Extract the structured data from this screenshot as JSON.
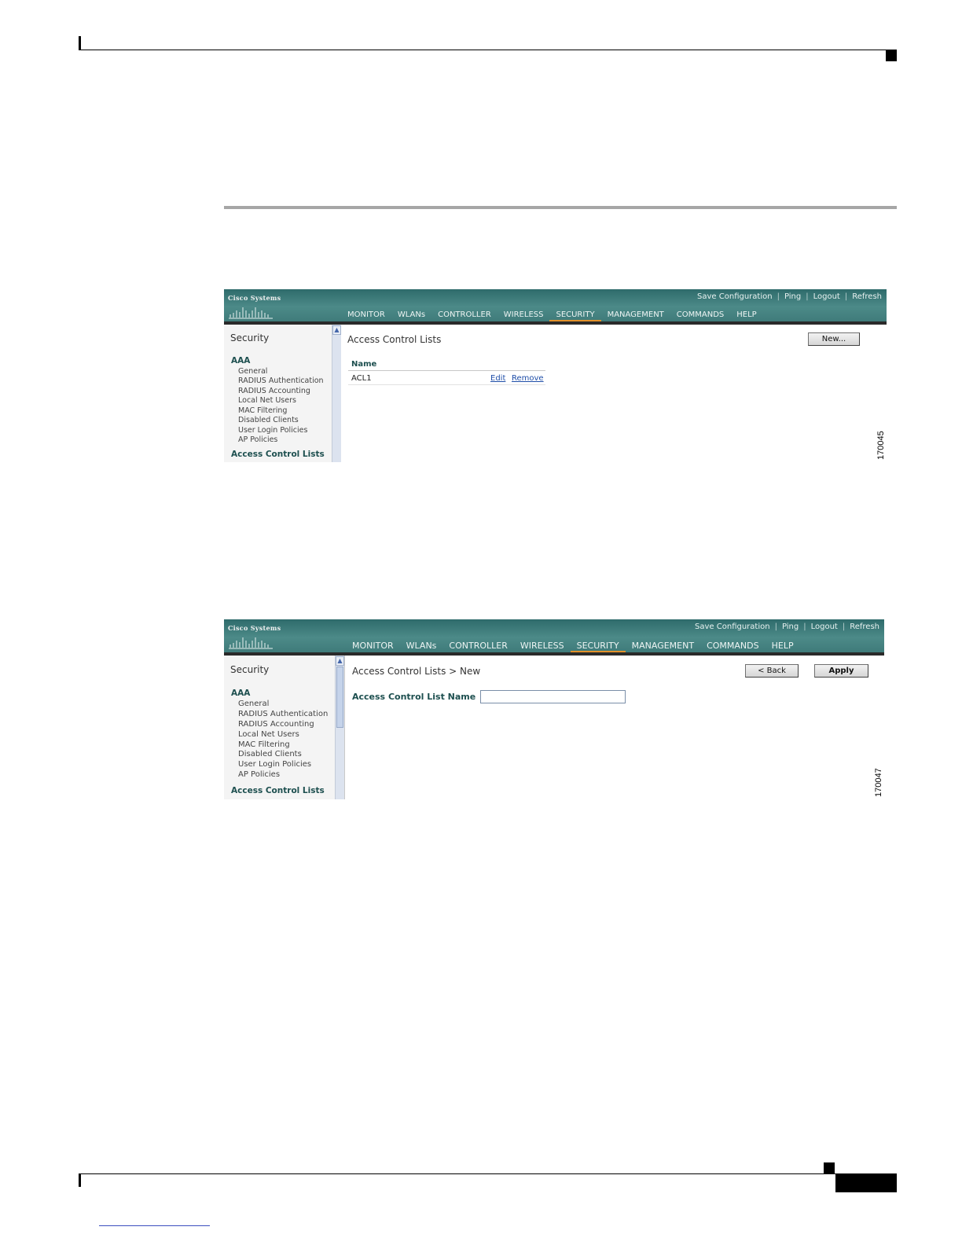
{
  "figure1": {
    "utility_links": [
      "Save Configuration",
      "Ping",
      "Logout",
      "Refresh"
    ],
    "logo_text": "Cisco Systems",
    "nav_items": [
      "MONITOR",
      "WLANs",
      "CONTROLLER",
      "WIRELESS",
      "SECURITY",
      "MANAGEMENT",
      "COMMANDS",
      "HELP"
    ],
    "active_nav": "SECURITY",
    "sidebar": {
      "title": "Security",
      "section": "AAA",
      "items": [
        "General",
        "RADIUS Authentication",
        "RADIUS Accounting",
        "Local Net Users",
        "MAC Filtering",
        "Disabled Clients",
        "User Login Policies",
        "AP Policies"
      ],
      "acl_label": "Access Control Lists"
    },
    "page_title": "Access Control Lists",
    "new_button": "New...",
    "table": {
      "column_header": "Name",
      "rows": [
        {
          "name": "ACL1",
          "edit": "Edit",
          "remove": "Remove"
        }
      ]
    },
    "figure_number": "170045"
  },
  "figure2": {
    "utility_links": [
      "Save Configuration",
      "Ping",
      "Logout",
      "Refresh"
    ],
    "logo_text": "Cisco Systems",
    "nav_items": [
      "MONITOR",
      "WLANs",
      "CONTROLLER",
      "WIRELESS",
      "SECURITY",
      "MANAGEMENT",
      "COMMANDS",
      "HELP"
    ],
    "active_nav": "SECURITY",
    "sidebar": {
      "title": "Security",
      "section": "AAA",
      "items": [
        "General",
        "RADIUS Authentication",
        "RADIUS Accounting",
        "Local Net Users",
        "MAC Filtering",
        "Disabled Clients",
        "User Login Policies",
        "AP Policies"
      ],
      "acl_label": "Access Control Lists"
    },
    "page_title": "Access Control Lists > New",
    "back_button": "< Back",
    "apply_button": "Apply",
    "field_label": "Access Control List Name",
    "field_value": "",
    "figure_number": "170047"
  }
}
